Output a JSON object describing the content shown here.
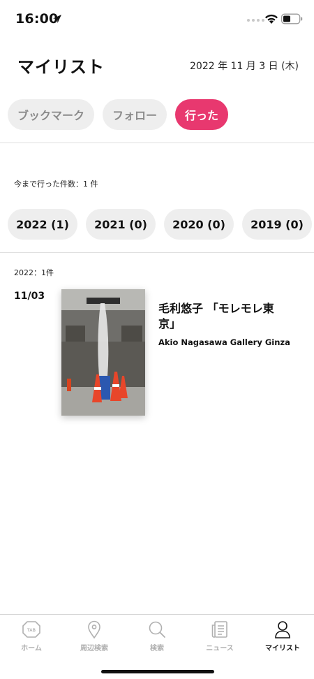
{
  "status_bar": {
    "time": "16:00"
  },
  "header": {
    "title": "マイリスト",
    "date": "2022 年 11 月 3 日 (木)"
  },
  "segment_tabs": [
    {
      "label": "ブックマーク",
      "active": false
    },
    {
      "label": "フォロー",
      "active": false
    },
    {
      "label": "行った",
      "active": true
    }
  ],
  "visited_count": "今まで行った件数：1 件",
  "year_chips": [
    "2022 (1)",
    "2021 (0)",
    "2020 (0)",
    "2019 (0)"
  ],
  "year_summary": "2022：1件",
  "entry": {
    "date": "11/03",
    "title": "毛利悠子 「モレモレ東京」",
    "venue": "Akio Nagasawa Gallery Ginza",
    "thumbnail_icon": "artwork-photo"
  },
  "tab_bar": [
    {
      "label": "ホーム",
      "icon": "home-icon",
      "active": false
    },
    {
      "label": "周辺検索",
      "icon": "location-pin-icon",
      "active": false
    },
    {
      "label": "検索",
      "icon": "search-icon",
      "active": false
    },
    {
      "label": "ニュース",
      "icon": "news-icon",
      "active": false
    },
    {
      "label": "マイリスト",
      "icon": "person-icon",
      "active": true
    }
  ],
  "colors": {
    "accent": "#e8386f",
    "chip_bg": "#eeeeee",
    "inactive_text": "#8a8a8a"
  }
}
